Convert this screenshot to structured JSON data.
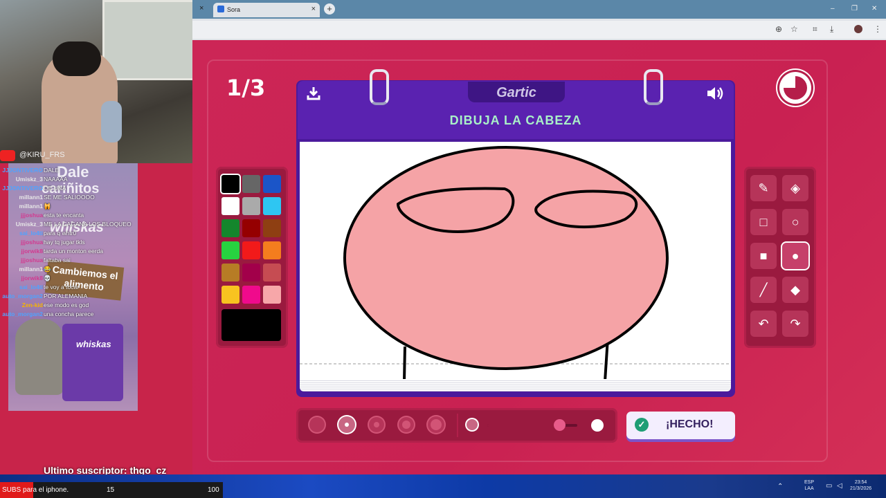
{
  "browser": {
    "tab_title": "Sora",
    "tab_close": "×",
    "new_tab": "+",
    "window_controls": [
      "–",
      "❐",
      "✕"
    ]
  },
  "game": {
    "round": "1/3",
    "logo": "Gartic",
    "prompt": "DIBUJA LA CABEZA",
    "done_label": "¡HECHO!",
    "colors": [
      "#000000",
      "#666666",
      "#1b55c8",
      "#ffffff",
      "#aaaaaa",
      "#2ec6f2",
      "#14862c",
      "#950000",
      "#8e3f12",
      "#27d240",
      "#f21a1a",
      "#f47d1e",
      "#b77c25",
      "#a2004a",
      "#c64c52",
      "#f8c320",
      "#f00a8c",
      "#f7a7a9"
    ],
    "selected_color": "#000000",
    "tools": [
      "pencil-icon",
      "eraser-icon",
      "square-outline-icon",
      "circle-outline-icon",
      "square-filled-icon",
      "circle-filled-icon",
      "line-icon",
      "fill-bucket-icon",
      "undo-icon",
      "redo-icon"
    ],
    "active_tool": "circle-filled-icon",
    "brush_sizes": [
      "XS",
      "S",
      "M",
      "L",
      "XL"
    ],
    "active_brush_size": "S",
    "opacity_fraction": 0.8
  },
  "stream": {
    "channel_handle": "@KIRU_FRS",
    "ad_text_1": "Dale",
    "ad_text_2": "cariñitos",
    "ad_brand": "whiskas",
    "ad_sign": "Cambiemos el alimento",
    "chat": [
      {
        "user": "JJJONTIVERO",
        "text": "DALE",
        "color": "#4fa3ff"
      },
      {
        "user": "Umiskz_3",
        "text": "NAAAAA",
        "color": "#e7e7e7"
      },
      {
        "user": "JJJONTIVERO",
        "text": "OE UNA",
        "color": "#4fa3ff"
      },
      {
        "user": "millann1",
        "text": "SE ME SALIOOOO",
        "color": "#e7e7e7"
      },
      {
        "user": "millann1",
        "text": "🙀",
        "color": "#e7e7e7"
      },
      {
        "user": "jjjoshua",
        "text": "esta te encanta",
        "color": "#d23a8f"
      },
      {
        "user": "Umiskz_3",
        "text": "ME LA CAGANA LOS BLOQUEO",
        "color": "#e7e7e7"
      },
      {
        "user": "sai_lo4ti",
        "text": "para q whtr0",
        "color": "#4fa3ff"
      },
      {
        "user": "jjjoshua",
        "text": "hay tq jugar tkls",
        "color": "#d23a8f"
      },
      {
        "user": "jjorwik8",
        "text": "tarda un monton eerda",
        "color": "#d23a8f"
      },
      {
        "user": "jjjoshua",
        "text": "faltaba sai",
        "color": "#d23a8f"
      },
      {
        "user": "millann1",
        "text": "😂",
        "color": "#e7e7e7"
      },
      {
        "user": "jjorwik8",
        "text": "💀",
        "color": "#d23a8f"
      },
      {
        "user": "sai_lo4ti",
        "text": "te voy a tocar",
        "color": "#4fa3ff"
      },
      {
        "user": "auto_morgan2",
        "text": "POR ALEMANIA",
        "color": "#4fa3ff"
      },
      {
        "user": "Zen-kid",
        "text": "ese modo es god",
        "color": "#f7b500"
      },
      {
        "user": "auto_morgan2",
        "text": "una concha parece",
        "color": "#4fa3ff"
      }
    ],
    "last_subscriber": "Ultimo suscriptor: thgo_cz",
    "subs_goal_label": "SUBS para el iphone.",
    "subs_current": "15",
    "subs_target": "100"
  },
  "taskbar": {
    "lang_top": "ESP",
    "lang_bottom": "LAA",
    "time": "23:54",
    "date": "21/3/2026"
  }
}
